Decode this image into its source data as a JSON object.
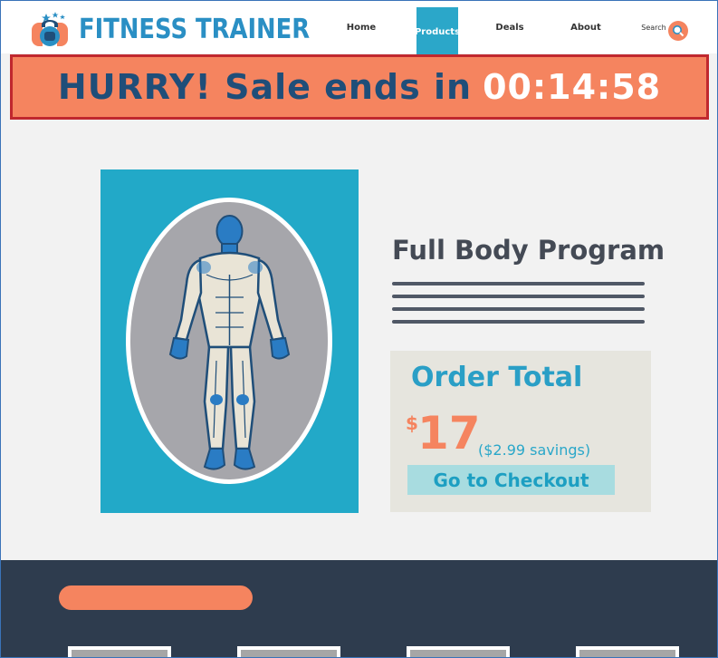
{
  "header": {
    "brand": "FITNESS TRAINER",
    "logo_icon": "kettlebell-logo-icon",
    "nav": {
      "home": "Home",
      "products": "Products",
      "deals": "Deals",
      "about": "About",
      "search": "Search"
    },
    "search_icon": "magnifier-icon",
    "active_tab": "Products"
  },
  "banner": {
    "text": "HURRY! Sale ends in",
    "time": "00:14:58"
  },
  "product": {
    "image_icon": "human-muscle-figure-icon",
    "title": "Full Body Program",
    "description_lines": 4
  },
  "order": {
    "title": "Order Total",
    "currency": "$",
    "price": "17",
    "savings": "($2.99 savings)",
    "checkout_label": "Go to Checkout"
  },
  "colors": {
    "brand_blue": "#2a8fc4",
    "accent_orange": "#f5845f",
    "banner_border": "#c0282e",
    "teal": "#22a9c8",
    "footer_bg": "#2e3c4e",
    "order_bg": "#e6e5de"
  }
}
